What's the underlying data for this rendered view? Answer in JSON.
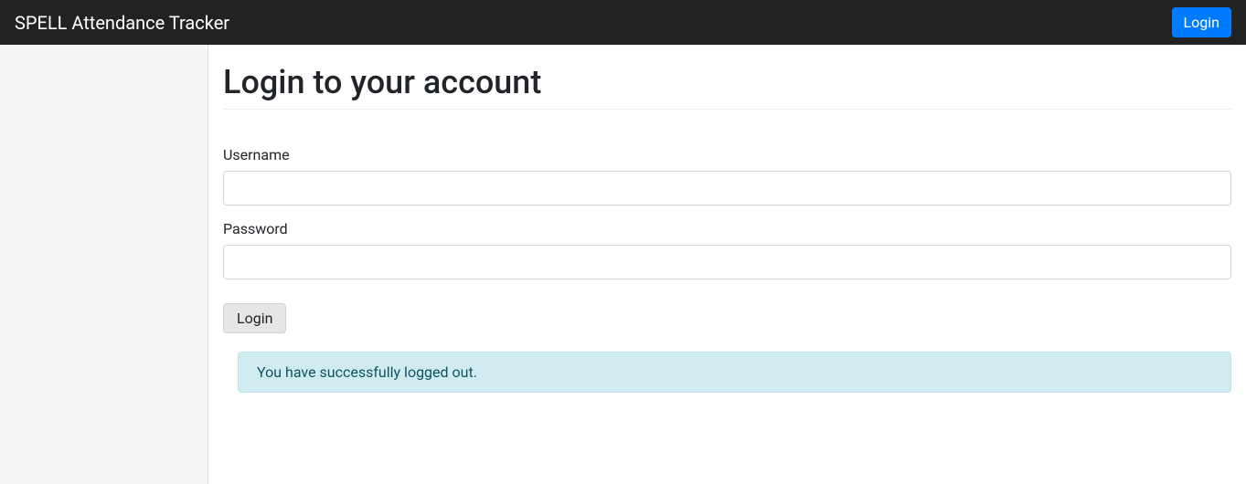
{
  "navbar": {
    "brand": "SPELL Attendance Tracker",
    "login_button": "Login"
  },
  "page": {
    "title": "Login to your account"
  },
  "form": {
    "username_label": "Username",
    "username_value": "",
    "password_label": "Password",
    "password_value": "",
    "submit_label": "Login"
  },
  "alert": {
    "message": "You have successfully logged out."
  }
}
